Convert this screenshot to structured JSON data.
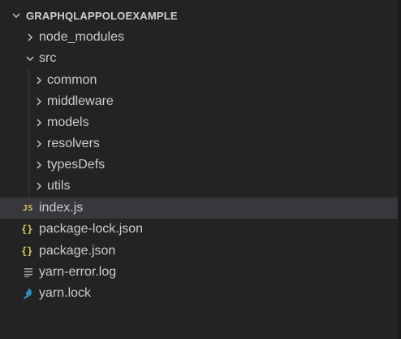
{
  "explorer": {
    "project_title": "GRAPHQLAPPOLOEXAMPLE",
    "items": [
      {
        "label": "node_modules",
        "kind": "folder",
        "expanded": false,
        "depth": 1
      },
      {
        "label": "src",
        "kind": "folder",
        "expanded": true,
        "depth": 1
      },
      {
        "label": "common",
        "kind": "folder",
        "expanded": false,
        "depth": 2
      },
      {
        "label": "middleware",
        "kind": "folder",
        "expanded": false,
        "depth": 2
      },
      {
        "label": "models",
        "kind": "folder",
        "expanded": false,
        "depth": 2
      },
      {
        "label": "resolvers",
        "kind": "folder",
        "expanded": false,
        "depth": 2
      },
      {
        "label": "typesDefs",
        "kind": "folder",
        "expanded": false,
        "depth": 2
      },
      {
        "label": "utils",
        "kind": "folder",
        "expanded": false,
        "depth": 2
      },
      {
        "label": "index.js",
        "kind": "file",
        "icon": "js-file-icon",
        "icon_text": "JS",
        "selected": true,
        "depth": 1
      },
      {
        "label": "package-lock.json",
        "kind": "file",
        "icon": "json-file-icon",
        "icon_text": "{}",
        "depth": 1
      },
      {
        "label": "package.json",
        "kind": "file",
        "icon": "json-file-icon",
        "icon_text": "{}",
        "depth": 1
      },
      {
        "label": "yarn-error.log",
        "kind": "file",
        "icon": "log-file-icon",
        "depth": 1
      },
      {
        "label": "yarn.lock",
        "kind": "file",
        "icon": "yarn-file-icon",
        "depth": 1
      }
    ]
  },
  "colors": {
    "background": "#232323",
    "selected_row": "#37373d",
    "text": "#cccccc",
    "json_accent": "#d7c95a",
    "yarn_accent": "#2c8ebb"
  }
}
